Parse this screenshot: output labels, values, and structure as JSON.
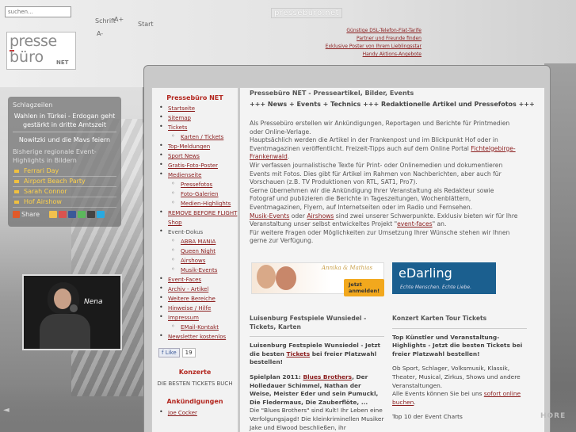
{
  "search": {
    "placeholder": "suchen..."
  },
  "logo": {
    "line1": "presse",
    "line2": "büro",
    "suffix": "NET"
  },
  "header": {
    "font_size_label": "Schrift",
    "font_plus": "A+",
    "font_minus": "A-",
    "start_link": "Start",
    "brand_watermark": "pressebüro.net"
  },
  "top_links": [
    "Günstige DSL-Telefon-Flat-Tarife",
    "Partner und Freunde finden",
    "Exklusive Poster von Ihrem Lieblingsstar",
    "Handy Aktions-Angebote"
  ],
  "left_box": {
    "head": "Schlagzeilen",
    "news": [
      "Wahlen in Türkei - Erdogan geht gestärkt in dritte Amtszeit",
      "Nowitzki und die Mavs feiern"
    ],
    "regional_title": "Bisherige regionale Event-Highlights in Bildern",
    "highlights": [
      "Ferrari Day",
      "Airport Beach Party",
      "Sarah Connor",
      "Hof Airshow"
    ],
    "share_label": "Share"
  },
  "photo": {
    "caption": "Nena"
  },
  "sidebar": {
    "title": "Pressebüro NET",
    "items": [
      {
        "label": "Startseite",
        "sub": false,
        "link": true
      },
      {
        "label": "Sitemap",
        "sub": false,
        "link": true
      },
      {
        "label": "Tickets",
        "sub": false,
        "link": true
      },
      {
        "label": "Karten / Tickets",
        "sub": true,
        "link": true
      },
      {
        "label": "Top-Meldungen",
        "sub": false,
        "link": true
      },
      {
        "label": "Sport News",
        "sub": false,
        "link": true
      },
      {
        "label": "Gratis-Foto-Poster",
        "sub": false,
        "link": true
      },
      {
        "label": "Medienseite",
        "sub": false,
        "link": true
      },
      {
        "label": "Pressefotos",
        "sub": true,
        "link": true
      },
      {
        "label": "Foto-Galerien",
        "sub": true,
        "link": true
      },
      {
        "label": "Medien-Highlights",
        "sub": true,
        "link": true
      },
      {
        "label": "REMOVE BEFORE FLIGHT Shop",
        "sub": false,
        "link": true
      },
      {
        "label": "Event-Dokus",
        "sub": false,
        "link": false
      },
      {
        "label": "ABBA MANIA",
        "sub": true,
        "link": true
      },
      {
        "label": "Queen Night",
        "sub": true,
        "link": true
      },
      {
        "label": "Airshows",
        "sub": true,
        "link": true
      },
      {
        "label": "Musik-Events",
        "sub": true,
        "link": true
      },
      {
        "label": "Event-Faces",
        "sub": false,
        "link": true
      },
      {
        "label": "Archiv - Artikel",
        "sub": false,
        "link": true
      },
      {
        "label": "Weitere Bereiche",
        "sub": false,
        "link": true
      },
      {
        "label": "Hinweise / Hilfe",
        "sub": false,
        "link": true
      },
      {
        "label": "Impressum",
        "sub": false,
        "link": true
      },
      {
        "label": "EMail-Kontakt",
        "sub": true,
        "link": true
      },
      {
        "label": "Newsletter kostenlos",
        "sub": false,
        "link": true
      }
    ],
    "like_label": "Like",
    "like_count": "19",
    "konzerte_title": "Konzerte",
    "konzerte_line": "DIE BESTEN TICKETS BUCH",
    "ankuendigungen_title": "Ankündigungen",
    "ankuendigungen_first": "Joe Cocker"
  },
  "content": {
    "heading": "Pressebüro NET - Presseartikel, Bilder, Events",
    "subheading": "+++ News + Events + Technics +++ Redaktionelle Artikel und Pressefotos +++",
    "intro_p1": "Als Pressebüro erstellen wir Ankündigungen, Reportagen und Berichte für Printmedien oder Online-Verlage.",
    "intro_p2a": "Hauptsächlich werden die Artikel in der Frankenpost und im Blickpunkt Hof oder in Eventmagazinen veröffentlicht. Freizeit-Tipps auch auf dem Online Portal ",
    "intro_link1": "Fichtelgebirge-Frankenwald",
    "intro_p2b": ".",
    "intro_p3": "Wir verfassen journalistische Texte für Print- oder Onlinemedien und dokumentieren Events mit Fotos. Dies gibt für Artikel im Rahmen von Nachberichten, aber auch für Vorschauen (z.B. TV Produktionen von RTL, SAT1, Pro7).",
    "intro_p4": "Gerne übernehmen wir die Ankündigung Ihrer Veranstaltung als Redakteur sowie Fotograf und publizieren die Berichte in Tageszeitungen, Wochenblättern, Eventmagazinen, Flyern, auf Internetseiten oder im Radio und Fernsehen.",
    "intro_link2": "Musik-Events",
    "intro_p5a": " oder ",
    "intro_link3": "Airshows",
    "intro_p5b": " sind zwei unserer Schwerpunkte. Exklusiv bieten wir für Ihre Veranstaltung unser selbst entwickeltes Projekt \"",
    "intro_link4": "event-faces",
    "intro_p5c": "\" an.",
    "intro_p6": "Für weitere Fragen oder Möglichkeiten zur Umsetzung Ihrer Wünsche stehen wir Ihnen gerne zur Verfügung.",
    "ad1_names": "Annika & Mathias",
    "ad1_button": "Jetzt anmelden!",
    "ad2_brand": "eDarling",
    "ad2_tag": "Echte Menschen. Echte Liebe."
  },
  "col_left": {
    "title": "Luisenburg Festspiele Wunsiedel - Tickets, Karten",
    "promo_a": "Luisenburg Festspiele Wunsiedel - Jetzt die besten ",
    "promo_link": "Tickets",
    "promo_b": " bei freier Platzwahl bestellen!",
    "spielplan_a": "Spielplan 2011: ",
    "spielplan_link": "Blues Brothers",
    "spielplan_b": ", Der Holledauer Schimmel, Nathan der Weise, Meister Eder und sein Pumuckl, Die Fledermaus, Die Zauberflöte, ...",
    "text": "Die \"Blues Brothers\" sind Kult! Ihr Leben eine Verfolgungsjagd! Die kleinkriminellen Musiker Jake und Elwood beschließen, ihr Waisenhaus,"
  },
  "col_right": {
    "title": "Konzert Karten Tour Tickets",
    "promo": "Top Künstler und Veranstaltung-Highlights - Jetzt die besten Tickets bei freier Platzwahl bestellen!",
    "text": "Ob Sport, Schlager, Volksmusik, Klassik, Theater, Musical, Zirkus, Shows und andere Veranstaltungen.",
    "events_a": "Alle Events können Sie bei uns ",
    "events_link": "sofort online buchen",
    "events_b": ".",
    "top_events": "Top 10 der Event Charts"
  },
  "watermark_right": "HORE"
}
